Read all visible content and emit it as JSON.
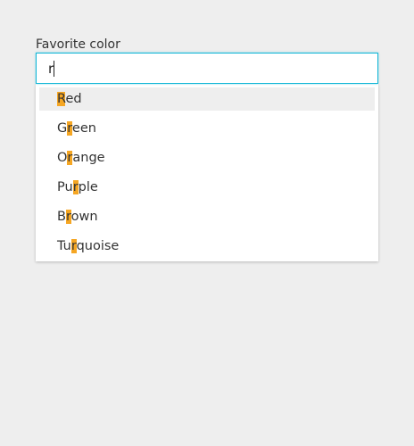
{
  "field": {
    "label": "Favorite color",
    "value": "r"
  },
  "colors": {
    "focus_border": "#12b7d6",
    "highlight": "#f5a623",
    "active_option_bg": "#eeeeee"
  },
  "options": [
    {
      "pre": "",
      "match": "R",
      "post": "ed",
      "active": true
    },
    {
      "pre": "G",
      "match": "r",
      "post": "een",
      "active": false
    },
    {
      "pre": "O",
      "match": "r",
      "post": "ange",
      "active": false
    },
    {
      "pre": "Pu",
      "match": "r",
      "post": "ple",
      "active": false
    },
    {
      "pre": "B",
      "match": "r",
      "post": "own",
      "active": false
    },
    {
      "pre": "Tu",
      "match": "r",
      "post": "quoise",
      "active": false
    }
  ]
}
